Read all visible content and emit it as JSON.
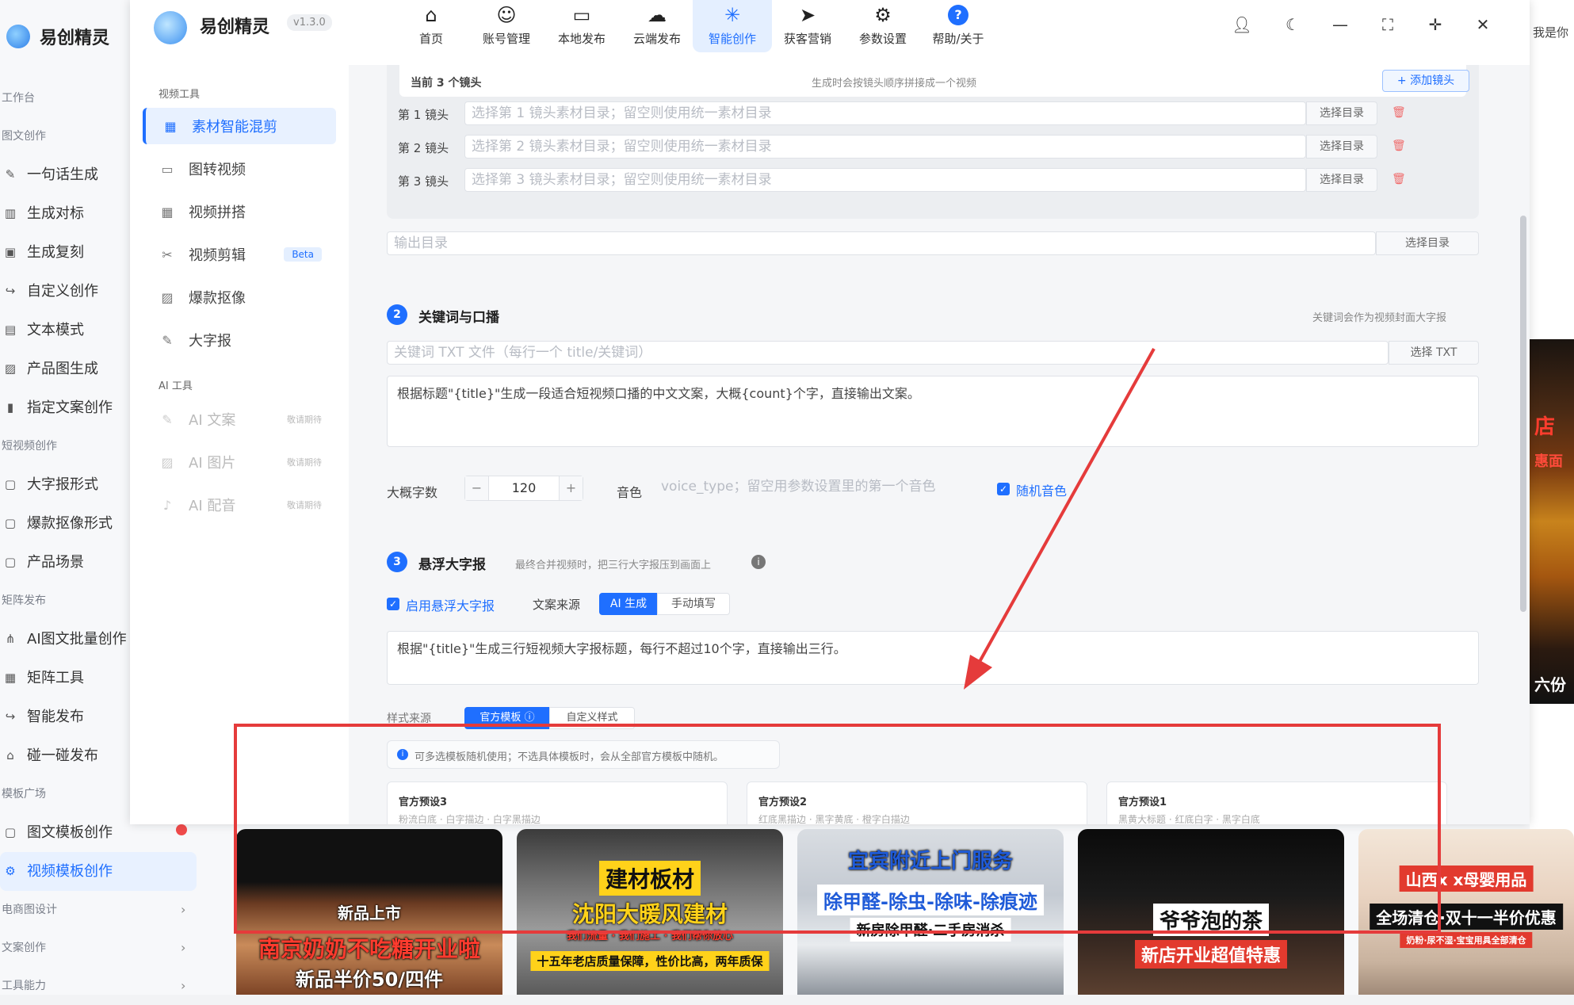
{
  "background_app": {
    "logo_text": "易创精灵",
    "menu": [
      {
        "kind": "group",
        "label": "工作台"
      },
      {
        "kind": "group",
        "label": "图文创作"
      },
      {
        "kind": "item",
        "label": "一句话生成",
        "icon": "pen-icon"
      },
      {
        "kind": "item",
        "label": "生成对标",
        "icon": "chart-icon"
      },
      {
        "kind": "item",
        "label": "生成复刻",
        "icon": "camera-icon"
      },
      {
        "kind": "item",
        "label": "自定义创作",
        "icon": "share-icon"
      },
      {
        "kind": "item",
        "label": "文本模式",
        "icon": "text-icon"
      },
      {
        "kind": "item",
        "label": "产品图生成",
        "icon": "image-icon"
      },
      {
        "kind": "item",
        "label": "指定文案创作",
        "icon": "doc-icon"
      },
      {
        "kind": "group",
        "label": "短视频创作"
      },
      {
        "kind": "item",
        "label": "大字报形式",
        "icon": "board-icon"
      },
      {
        "kind": "item",
        "label": "爆款抠像形式",
        "icon": "board-icon"
      },
      {
        "kind": "item",
        "label": "产品场景",
        "icon": "board-icon"
      },
      {
        "kind": "group",
        "label": "矩阵发布"
      },
      {
        "kind": "item",
        "label": "AI图文批量创作",
        "icon": "tree-icon"
      },
      {
        "kind": "item",
        "label": "矩阵工具",
        "icon": "grid-icon"
      },
      {
        "kind": "item",
        "label": "智能发布",
        "icon": "share-icon"
      },
      {
        "kind": "item",
        "label": "碰一碰发布",
        "icon": "home-icon"
      },
      {
        "kind": "group",
        "label": "模板广场"
      },
      {
        "kind": "item",
        "label": "图文模板创作",
        "icon": "board-icon"
      },
      {
        "kind": "item",
        "label": "视频模板创作",
        "icon": "gear-icon",
        "active": true
      },
      {
        "kind": "group-collapsible",
        "label": "电商图设计"
      },
      {
        "kind": "group-collapsible",
        "label": "文案创作"
      },
      {
        "kind": "group-collapsible",
        "label": "工具能力"
      }
    ],
    "right_strip_text": "我是你"
  },
  "window": {
    "app_name": "易创精灵",
    "version": "v1.3.0",
    "nav": [
      {
        "label": "首页",
        "icon": "home-icon"
      },
      {
        "label": "账号管理",
        "icon": "user-icon"
      },
      {
        "label": "本地发布",
        "icon": "monitor-icon"
      },
      {
        "label": "云端发布",
        "icon": "cloud-icon"
      },
      {
        "label": "智能创作",
        "icon": "sparkle-icon",
        "active": true
      },
      {
        "label": "获客营销",
        "icon": "send-icon"
      },
      {
        "label": "参数设置",
        "icon": "gear-icon"
      },
      {
        "label": "帮助/关于",
        "icon": "help-icon"
      }
    ]
  },
  "tools": {
    "video_group": "视频工具",
    "video_items": [
      {
        "label": "素材智能混剪",
        "icon": "table-icon",
        "active": true
      },
      {
        "label": "图转视频",
        "icon": "video-icon"
      },
      {
        "label": "视频拼搭",
        "icon": "table-icon"
      },
      {
        "label": "视频剪辑",
        "icon": "scissor-icon",
        "badge": "Beta"
      },
      {
        "label": "爆款抠像",
        "icon": "image-icon"
      },
      {
        "label": "大字报",
        "icon": "pen-icon"
      }
    ],
    "ai_group": "AI 工具",
    "ai_items": [
      {
        "label": "AI 文案",
        "icon": "pen-icon",
        "tag": "敬请期待"
      },
      {
        "label": "AI 图片",
        "icon": "image-icon",
        "tag": "敬请期待"
      },
      {
        "label": "AI 配音",
        "icon": "mic-icon",
        "tag": "敬请期待"
      }
    ]
  },
  "shots": {
    "current_label": "当前 3 个镜头",
    "hint": "生成时会按镜头顺序拼接成一个视频",
    "add_button": "+ 添加镜头",
    "rows": [
      {
        "label": "第 1 镜头",
        "placeholder": "选择第 1 镜头素材目录；留空则使用统一素材目录",
        "button": "选择目录"
      },
      {
        "label": "第 2 镜头",
        "placeholder": "选择第 2 镜头素材目录；留空则使用统一素材目录",
        "button": "选择目录"
      },
      {
        "label": "第 3 镜头",
        "placeholder": "选择第 3 镜头素材目录；留空则使用统一素材目录",
        "button": "选择目录"
      }
    ],
    "output_placeholder": "输出目录",
    "output_button": "选择目录"
  },
  "section2": {
    "num": "2",
    "title": "关键词与口播",
    "hint": "关键词会作为视频封面大字报",
    "keyword_placeholder": "关键词 TXT 文件（每行一个 title/关键词）",
    "keyword_button": "选择 TXT",
    "prompt": "根据标题\"{title}\"生成一段适合短视频口播的中文文案，大概{count}个字，直接输出文案。",
    "count_label": "大概字数",
    "count_value": "120",
    "minus": "−",
    "plus": "+",
    "voice_label": "音色",
    "voice_placeholder": "voice_type；留空用参数设置里的第一个音色",
    "random_voice_label": "随机音色"
  },
  "section3": {
    "num": "3",
    "title": "悬浮大字报",
    "hint": "最终合并视频时，把三行大字报压到画面上",
    "enable_label": "启用悬浮大字报",
    "source_label": "文案来源",
    "source_ai": "AI 生成",
    "source_manual": "手动填写",
    "prompt": "根据\"{title}\"生成三行短视频大字报标题，每行不超过10个字，直接输出三行。",
    "style_label": "样式来源",
    "style_official": "官方模板",
    "style_custom": "自定义样式",
    "info": "可多选模板随机使用；不选具体模板时，会从全部官方模板中随机。",
    "presets": [
      {
        "title": "官方预设3",
        "sub": "粉流白底 · 白字描边 · 白字黑描边"
      },
      {
        "title": "官方预设2",
        "sub": "红底黑描边 · 黑字黄底 · 橙字白描边"
      },
      {
        "title": "官方预设1",
        "sub": "黑黄大标题 · 红底白字 · 黑字白底"
      }
    ]
  },
  "thumbnails": [
    {
      "top": "新品上市",
      "main": "南京奶奶不吃糖开业啦",
      "sub": "新品半价50/四件"
    },
    {
      "top": "建材板材",
      "main": "沈阳大暖风建材",
      "sub": "我们流量 · 我们施工 · 我们帮你放心",
      "foot": "十五年老店质量保障，性价比高，两年质保"
    },
    {
      "top": "宜宾附近上门服务",
      "main": "除甲醛-除虫-除味-除痕迹",
      "sub": "新房除甲醛·二手房消杀"
    },
    {
      "top": "爷爷泡的茶",
      "main": "新店开业超值特惠"
    },
    {
      "top": "山西x x母婴用品",
      "main": "全场清仓·双十一半价优惠",
      "sub": "奶粉·尿不湿·宝宝用具全部清仓"
    }
  ],
  "colors": {
    "accent": "#1f6fff",
    "annotation": "#e53b3b"
  }
}
